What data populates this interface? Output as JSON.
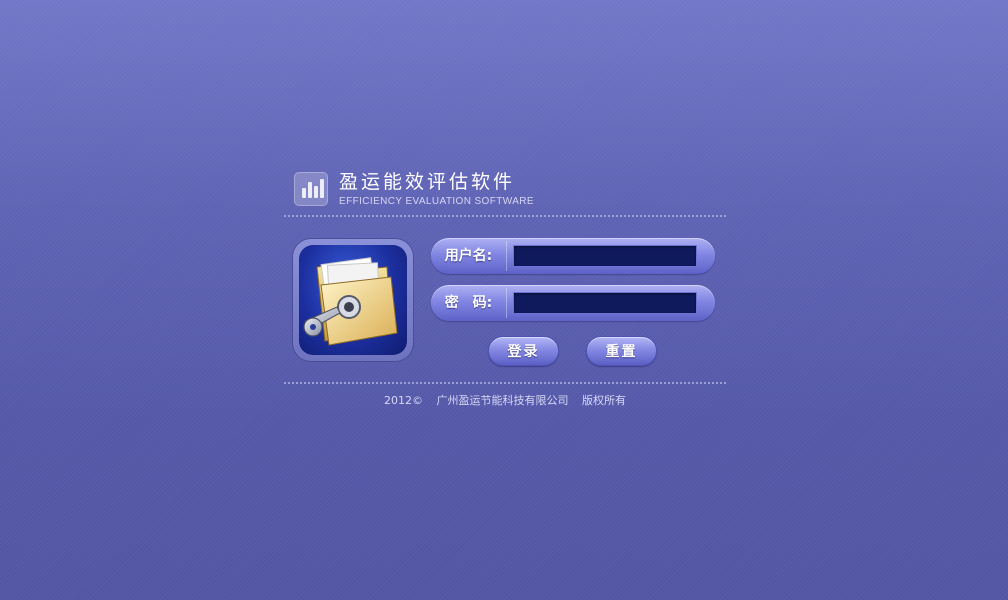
{
  "app": {
    "title": "盈运能效评估软件",
    "subtitle": "EFFICIENCY EVALUATION SOFTWARE"
  },
  "icons": {
    "logo": "bar-chart-icon",
    "login_art": "folder-key-icon"
  },
  "form": {
    "username_label": "用户名:",
    "username_value": "",
    "password_label": "密　码:",
    "password_value": "",
    "login_button": "登录",
    "reset_button": "重置"
  },
  "footer": {
    "year_copyright": "2012©",
    "company": "广州盈运节能科技有限公司",
    "rights": "版权所有"
  },
  "colors": {
    "background": "#5f62b0",
    "input_background": "#0f1a5c",
    "button_accent": "#8589e3"
  }
}
